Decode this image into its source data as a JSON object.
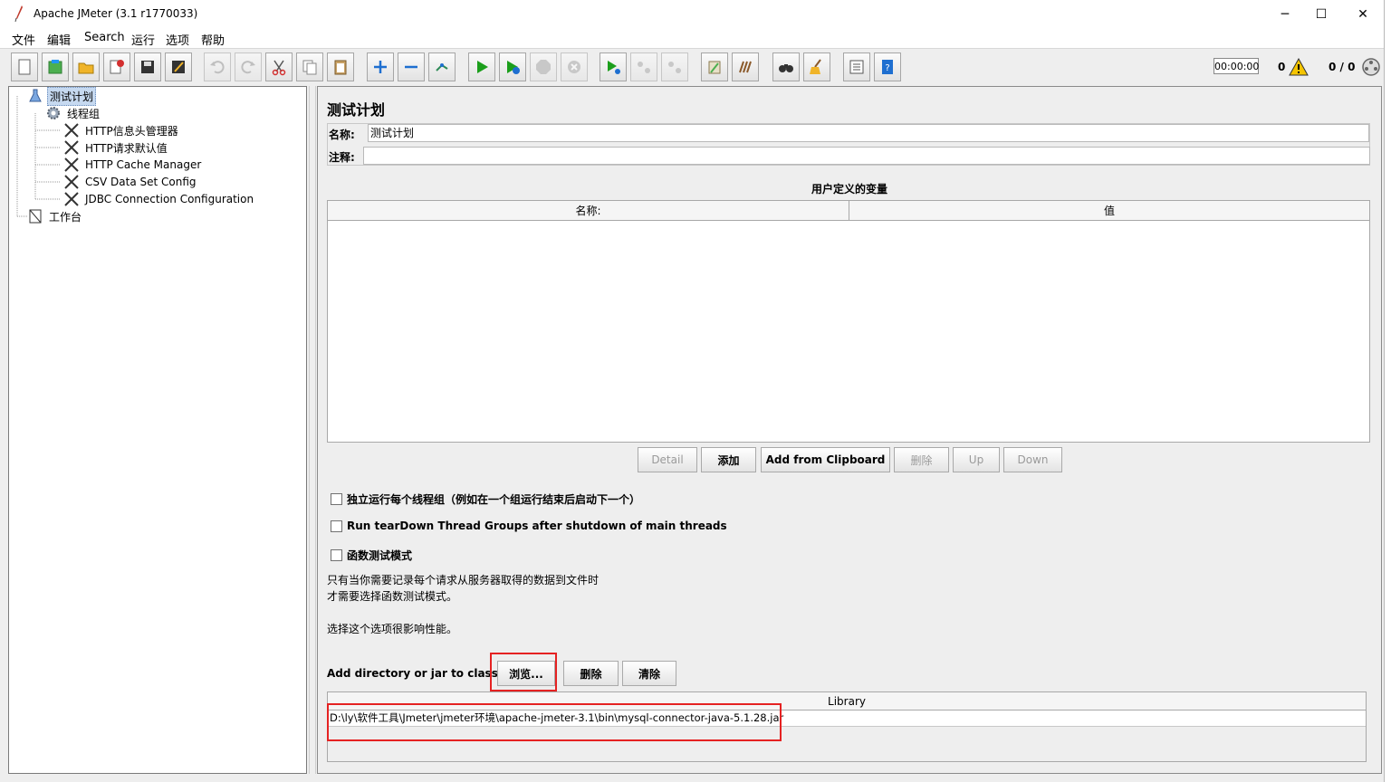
{
  "window": {
    "title": "Apache JMeter (3.1 r1770033)",
    "minimize": "─",
    "maximize": "☐",
    "close": "✕"
  },
  "menu": [
    "文件",
    "编辑",
    "Search",
    "运行",
    "选项",
    "帮助"
  ],
  "toolbar": {
    "timer": "00:00:00",
    "error_count": "0",
    "threads": "0 / 0"
  },
  "tree": {
    "nodes": [
      {
        "label": "测试计划",
        "icon": "flask-icon"
      },
      {
        "label": "线程组",
        "icon": "gear-icon"
      },
      {
        "label": "HTTP信息头管理器",
        "icon": "config-tools-icon"
      },
      {
        "label": "HTTP请求默认值",
        "icon": "config-tools-icon"
      },
      {
        "label": "HTTP Cache Manager",
        "icon": "config-tools-icon"
      },
      {
        "label": "CSV Data Set Config",
        "icon": "config-tools-icon"
      },
      {
        "label": "JDBC Connection Configuration",
        "icon": "config-tools-icon"
      },
      {
        "label": "工作台",
        "icon": "workbench-icon"
      }
    ]
  },
  "main": {
    "heading": "测试计划",
    "name_label": "名称:",
    "name_value": "测试计划",
    "comment_label": "注释:",
    "comment_value": "",
    "variables_title": "用户定义的变量",
    "variables_columns": [
      "名称:",
      "值"
    ],
    "variable_buttons": [
      "Detail",
      "添加",
      "Add from Clipboard",
      "删除",
      "Up",
      "Down"
    ],
    "check_serial": "独立运行每个线程组（例如在一个组运行结束后启动下一个）",
    "check_teardown": "Run tearDown Thread Groups after shutdown of main threads",
    "check_functional": "函数测试模式",
    "note_line1": "只有当你需要记录每个请求从服务器取得的数据到文件时",
    "note_line2": "才需要选择函数测试模式。",
    "note_line3": "选择这个选项很影响性能。",
    "classpath_label": "Add directory or jar to classpath",
    "browse_button": "浏览...",
    "delete_button": "删除",
    "clear_button": "清除",
    "library_header": "Library",
    "library_rows": [
      "D:\\ly\\软件工具\\Jmeter\\jmeter环境\\apache-jmeter-3.1\\bin\\mysql-connector-java-5.1.28.jar"
    ]
  },
  "colors": {
    "highlight_box": "#e52222",
    "selection": "#c6d9f0"
  }
}
